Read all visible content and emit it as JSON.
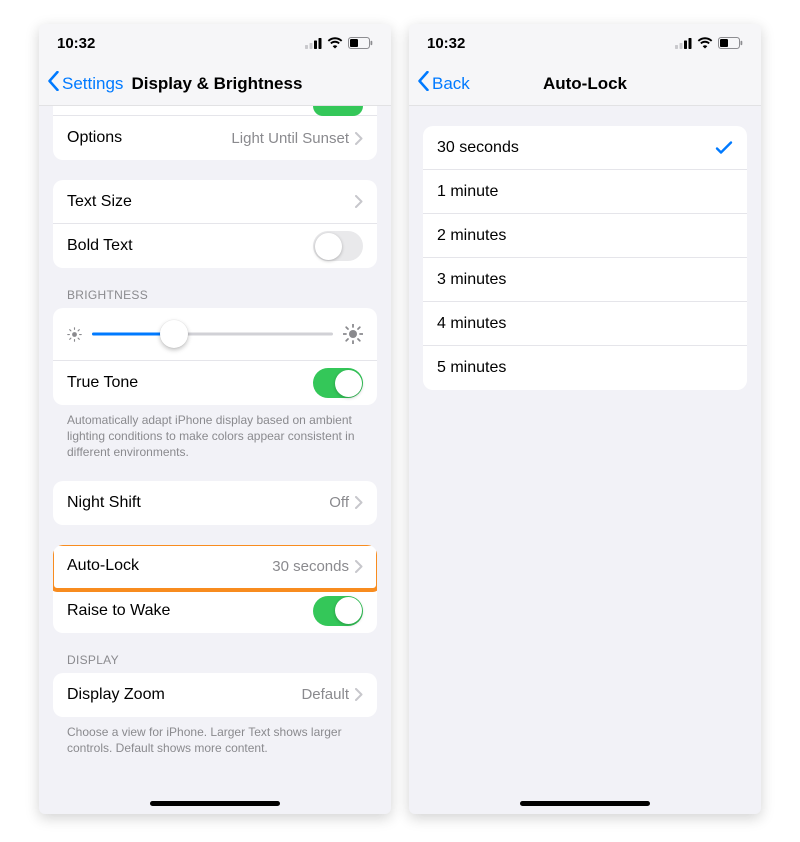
{
  "status": {
    "time": "10:32"
  },
  "phone1": {
    "nav": {
      "back": "Settings",
      "title": "Display & Brightness"
    },
    "options": {
      "label": "Options",
      "value": "Light Until Sunset"
    },
    "text_size": {
      "label": "Text Size"
    },
    "bold_text": {
      "label": "Bold Text",
      "on": false
    },
    "brightness_header": "BRIGHTNESS",
    "brightness": {
      "percent": 34
    },
    "true_tone": {
      "label": "True Tone",
      "on": true
    },
    "true_tone_footer": "Automatically adapt iPhone display based on ambient lighting conditions to make colors appear consistent in different environments.",
    "night_shift": {
      "label": "Night Shift",
      "value": "Off"
    },
    "auto_lock": {
      "label": "Auto-Lock",
      "value": "30 seconds"
    },
    "raise_to_wake": {
      "label": "Raise to Wake",
      "on": true
    },
    "display_header": "DISPLAY",
    "display_zoom": {
      "label": "Display Zoom",
      "value": "Default"
    },
    "display_zoom_footer": "Choose a view for iPhone. Larger Text shows larger controls. Default shows more content."
  },
  "phone2": {
    "nav": {
      "back": "Back",
      "title": "Auto-Lock"
    },
    "options": [
      {
        "label": "30 seconds",
        "selected": true
      },
      {
        "label": "1 minute",
        "selected": false
      },
      {
        "label": "2 minutes",
        "selected": false
      },
      {
        "label": "3 minutes",
        "selected": false
      },
      {
        "label": "4 minutes",
        "selected": false
      },
      {
        "label": "5 minutes",
        "selected": false
      }
    ]
  }
}
